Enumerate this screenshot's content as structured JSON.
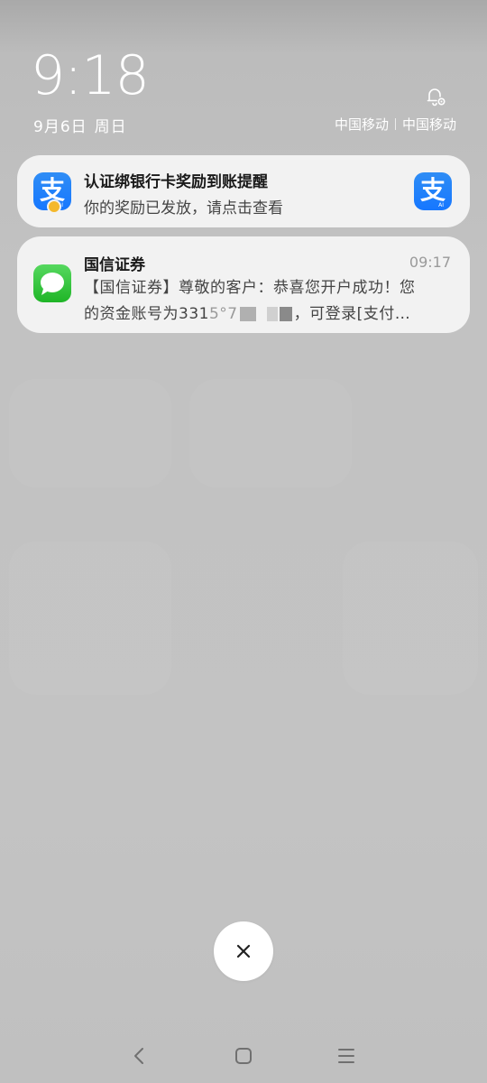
{
  "status": {
    "time": "9:18",
    "date": "9月6日",
    "weekday": "周日",
    "carriers": [
      "中国移动",
      "中国移动"
    ]
  },
  "notifications": [
    {
      "app_icon": "alipay-icon",
      "title": "认证绑银行卡奖励到账提醒",
      "body": "你的奖励已发放，请点击查看",
      "accent": "#1677ff"
    },
    {
      "app_icon": "messages-icon",
      "title": "国信证券",
      "time": "09:17",
      "body_line1": "【国信证券】尊敬的客户：恭喜您开户成功！您",
      "body_line2_prefix": "的资金账号为331",
      "body_line2_partial": "5°7",
      "body_line2_suffix": "，可登录[支付…",
      "accent": "#2fc236"
    }
  ],
  "controls": {
    "close_icon": "close-icon"
  },
  "nav": {
    "back_icon": "back-icon",
    "home_icon": "home-icon",
    "menu_icon": "menu-icon"
  }
}
